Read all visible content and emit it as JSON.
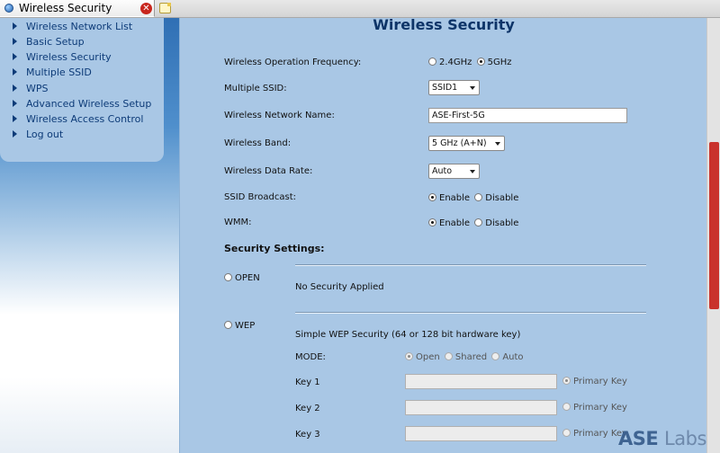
{
  "browser": {
    "tab_title": "Wireless Security",
    "favicon_icon": "globe-icon",
    "close_icon": "close-icon",
    "new_tab_icon": "new-tab-icon"
  },
  "nav": {
    "items": [
      {
        "label": "Wireless Network List"
      },
      {
        "label": "Basic Setup"
      },
      {
        "label": "Wireless Security"
      },
      {
        "label": "Multiple SSID"
      },
      {
        "label": "WPS"
      },
      {
        "label": "Advanced Wireless Setup"
      },
      {
        "label": "Wireless Access Control"
      },
      {
        "label": "Log out"
      }
    ]
  },
  "page": {
    "title": "Wireless Security"
  },
  "form": {
    "freq_label": "Wireless Operation Frequency:",
    "freq_opt1": "2.4GHz",
    "freq_opt2": "5GHz",
    "freq_selected": "5GHz",
    "mssid_label": "Multiple SSID:",
    "mssid_value": "SSID1",
    "name_label": "Wireless Network Name:",
    "name_value": "ASE-First-5G",
    "band_label": "Wireless Band:",
    "band_value": "5 GHz (A+N)",
    "rate_label": "Wireless Data Rate:",
    "rate_value": "Auto",
    "ssid_bc_label": "SSID Broadcast:",
    "wmm_label": "WMM:",
    "enable": "Enable",
    "disable": "Disable",
    "ssid_bc_selected": "Enable",
    "wmm_selected": "Enable"
  },
  "security": {
    "title": "Security Settings:",
    "open_label": "OPEN",
    "open_desc": "No Security Applied",
    "wep_label": "WEP",
    "wep_desc": "Simple WEP Security (64 or 128 bit hardware key)",
    "mode_label": "MODE:",
    "mode_opt1": "Open",
    "mode_opt2": "Shared",
    "mode_opt3": "Auto",
    "mode_selected": "Open",
    "key1_label": "Key 1",
    "key2_label": "Key 2",
    "key3_label": "Key 3",
    "primary_key": "Primary Key",
    "primary_selected": "Key 1"
  },
  "watermark": {
    "part1": "ASE",
    "part2": "Labs"
  },
  "colors": {
    "panel_bg": "#a9c7e5",
    "title": "#0d3468",
    "nav_text": "#0d3b78",
    "scroll_thumb": "#c9322c"
  }
}
